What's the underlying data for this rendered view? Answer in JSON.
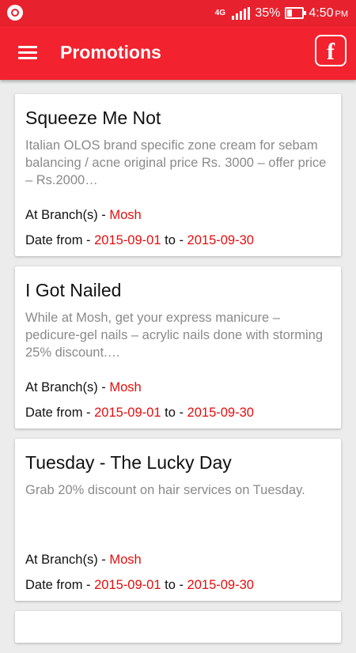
{
  "status_bar": {
    "network": "4G",
    "battery": "35%",
    "time": "4:50",
    "ampm": "PM"
  },
  "app_bar": {
    "title": "Promotions"
  },
  "labels": {
    "branch_prefix": "At Branch(s) - ",
    "date_from_prefix": "Date from - ",
    "date_to_prefix": "to - "
  },
  "promotions": [
    {
      "title": "Squeeze Me Not",
      "description": "Italian OLOS brand specific zone cream for sebam balancing / acne original price Rs. 3000 – offer price – Rs.2000…",
      "branch": "Mosh",
      "date_from": "2015-09-01",
      "date_to": "2015-09-30"
    },
    {
      "title": "I Got Nailed",
      "description": "While at Mosh, get your  express manicure – pedicure-gel nails – acrylic nails done with storming 25% discount.…",
      "branch": "Mosh",
      "date_from": "2015-09-01",
      "date_to": "2015-09-30"
    },
    {
      "title": "Tuesday - The Lucky Day",
      "description": "Grab 20% discount on hair services on Tuesday.",
      "branch": "Mosh",
      "date_from": "2015-09-01",
      "date_to": "2015-09-30"
    }
  ]
}
